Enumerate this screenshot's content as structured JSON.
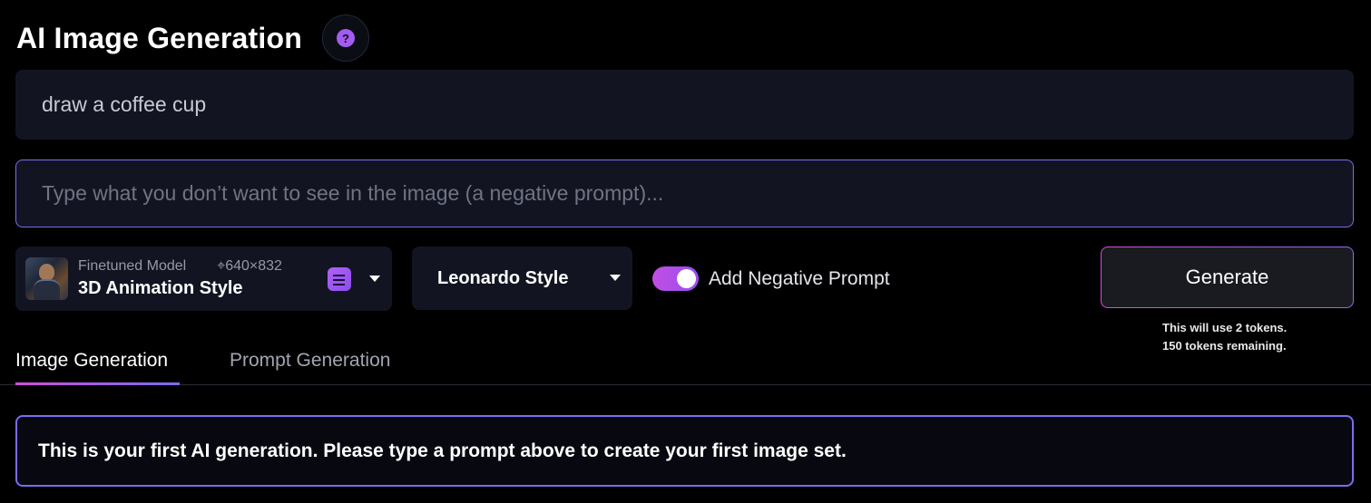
{
  "header": {
    "title": "AI Image Generation",
    "help_glyph": "?"
  },
  "prompt": {
    "value": "draw a coffee cup"
  },
  "negative_prompt": {
    "placeholder": "Type what you don’t want to see in the image (a negative prompt)..."
  },
  "model": {
    "kind_label": "Finetuned Model",
    "dimensions": "⌖640×832",
    "name": "3D Animation Style"
  },
  "style": {
    "selected": "Leonardo Style"
  },
  "negative_toggle": {
    "label": "Add Negative Prompt",
    "enabled": true
  },
  "generate": {
    "label": "Generate",
    "token_line_1": "This will use 2 tokens.",
    "token_line_2": "150 tokens remaining."
  },
  "tabs": [
    {
      "label": "Image Generation",
      "active": true
    },
    {
      "label": "Prompt Generation",
      "active": false
    }
  ],
  "banner": {
    "text": "This is your first AI generation. Please type a prompt above to create your first image set."
  },
  "colors": {
    "accent_purple": "#7b6cf0",
    "accent_pink": "#d14fd8",
    "panel_bg": "#121521",
    "page_bg": "#000000"
  }
}
